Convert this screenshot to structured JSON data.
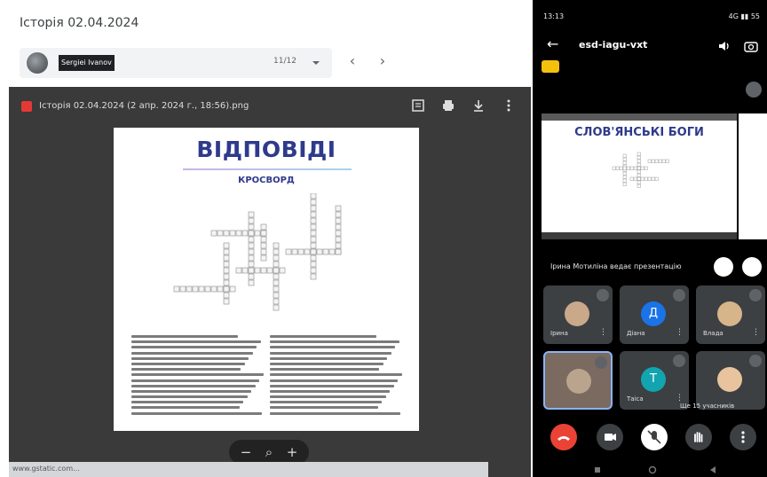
{
  "viewer": {
    "title": "Історія 02.04.2024",
    "user_label": "Sergiei Ivanov",
    "page_count": "11/12",
    "file_name": "Історія 02.04.2024 (2 апр. 2024 г., 18:56).png",
    "doc": {
      "heading": "ВІДПОВІДІ",
      "subheading": "КРОСВОРД"
    },
    "status_url": "www.gstatic.com..."
  },
  "meet": {
    "status_time": "13:13",
    "status_right": "4G ▮▮ 55",
    "meeting_code": "esd-iagu-vxt",
    "slide_title": "СЛОВ'ЯНСЬКІ БОГИ",
    "presenting_label": "Ірина Мотиліна ведає презентацію",
    "participants": [
      {
        "initial": "",
        "name": "Ірина",
        "color": "#c9a98a"
      },
      {
        "initial": "Д",
        "name": "Діана",
        "color": "#1a73e8"
      },
      {
        "initial": "",
        "name": "Влада",
        "color": "#d7b58a"
      },
      {
        "initial": "",
        "name": "",
        "color": "#bba48e"
      },
      {
        "initial": "Т",
        "name": "Таіса",
        "color": "#12a4af"
      },
      {
        "initial": "",
        "name": "",
        "color": "#e8c39e"
      }
    ],
    "more_label": "Ще 15 учасників"
  },
  "colors": {
    "doc_heading": "#2e3a8c",
    "leave_call": "#ea4335",
    "badge": "#f4c20d"
  }
}
